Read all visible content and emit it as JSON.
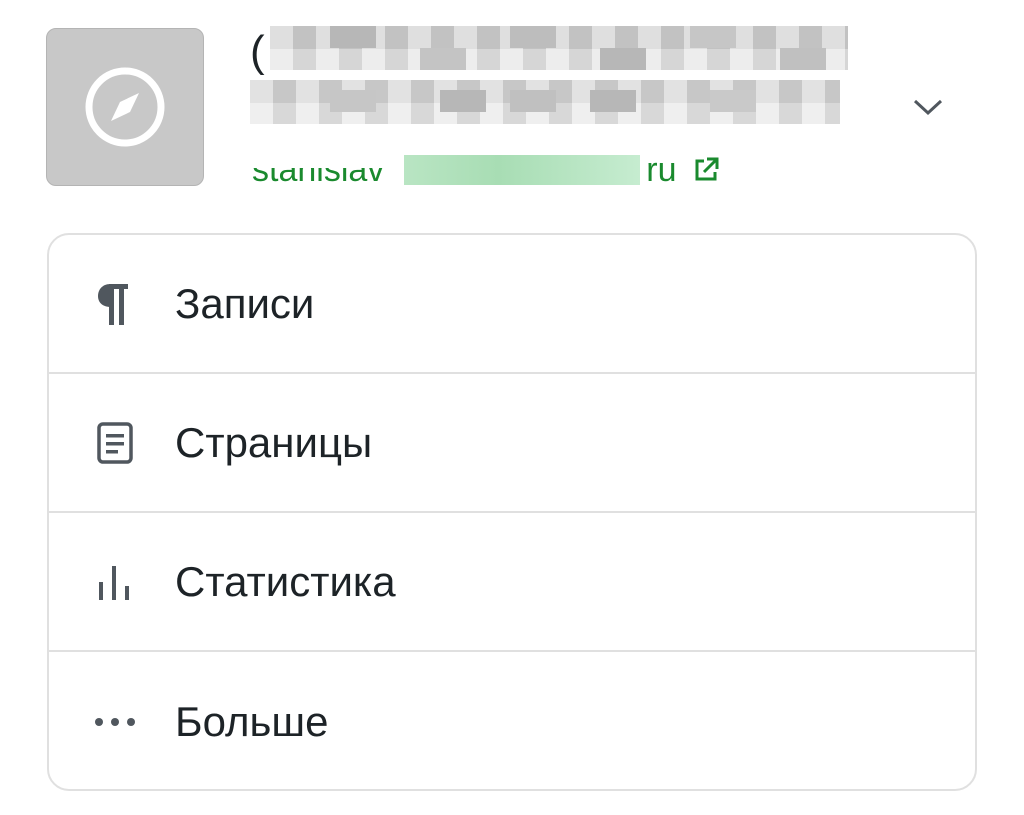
{
  "site": {
    "title_visible_prefix": "(",
    "url_prefix": "stanislav",
    "url_suffix": "ru",
    "icon": "compass-icon",
    "link_icon": "external-link-icon",
    "toggle_icon": "chevron-down-icon",
    "link_color": "#1a8a2e"
  },
  "menu": {
    "items": [
      {
        "label": "Записи",
        "icon": "pilcrow-icon"
      },
      {
        "label": "Страницы",
        "icon": "page-icon"
      },
      {
        "label": "Статистика",
        "icon": "bar-chart-icon"
      },
      {
        "label": "Больше",
        "icon": "more-dots-icon"
      }
    ]
  }
}
